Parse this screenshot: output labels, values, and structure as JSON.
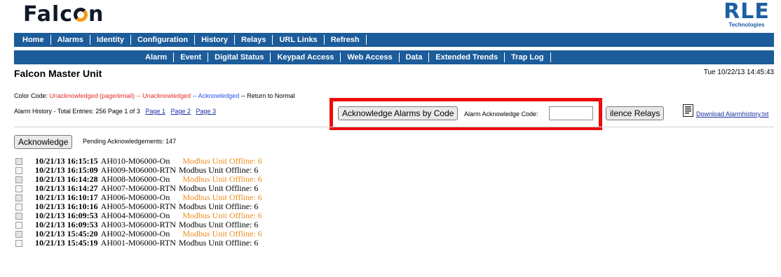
{
  "header": {
    "logo_left": "Falcon",
    "logo_right_main": "RLE",
    "logo_right_sub": "Technologies"
  },
  "nav_primary": [
    "Home",
    "Alarms",
    "Identity",
    "Configuration",
    "History",
    "Relays",
    "URL Links",
    "Refresh"
  ],
  "nav_secondary": [
    "Alarm",
    "Event",
    "Digital Status",
    "Keypad Access",
    "Web Access",
    "Data",
    "Extended Trends",
    "Trap Log"
  ],
  "page": {
    "title": "Falcon Master Unit",
    "datetime": "Tue 10/22/13 14:45:43"
  },
  "color_code": {
    "label": "Color Code: ",
    "unack_email": "Unacknowledged (page/email)",
    "sep1": " -- ",
    "unack": "Unacknowledged",
    "sep2": " -- ",
    "ack": "Acknowledged",
    "sep3": " -- ",
    "rtn": "Return to Normal"
  },
  "history": {
    "summary": "Alarm History - Total Entries: 256  Page 1 of 3",
    "pages": [
      "Page 1",
      "Page 2",
      "Page 3"
    ]
  },
  "ack_by_code": {
    "button": "Acknowledge Alarms by Code",
    "label": "Alarm Acknowledge Code:",
    "value": ""
  },
  "silence_button": "Silence Relays",
  "silence_button_visible": "ilence Relays",
  "download_link": "Download Alarmhistory.txt",
  "acknowledge_button": "Acknowledge",
  "pending": "Pending Acknowledgements: 147",
  "colors": {
    "nav_bg": "#1c5c9a",
    "unacknowledged": "#f08c1e",
    "highlight_box": "#ee0b0b"
  },
  "alarms": [
    {
      "stamp": "10/21/13 16:15:15",
      "code": "AH010-M06000-On",
      "msg": "Modbus Unit Offline: 6",
      "state": "on"
    },
    {
      "stamp": "10/21/13 16:15:09",
      "code": "AH009-M06000-RTN",
      "msg": "Modbus Unit Offline: 6",
      "state": "rtn"
    },
    {
      "stamp": "10/21/13 16:14:28",
      "code": "AH008-M06000-On",
      "msg": "Modbus Unit Offline: 6",
      "state": "on"
    },
    {
      "stamp": "10/21/13 16:14:27",
      "code": "AH007-M06000-RTN",
      "msg": "Modbus Unit Offline: 6",
      "state": "rtn"
    },
    {
      "stamp": "10/21/13 16:10:17",
      "code": "AH006-M06000-On",
      "msg": "Modbus Unit Offline: 6",
      "state": "on"
    },
    {
      "stamp": "10/21/13 16:10:16",
      "code": "AH005-M06000-RTN",
      "msg": "Modbus Unit Offline: 6",
      "state": "rtn"
    },
    {
      "stamp": "10/21/13 16:09:53",
      "code": "AH004-M06000-On",
      "msg": "Modbus Unit Offline: 6",
      "state": "on"
    },
    {
      "stamp": "10/21/13 16:09:53",
      "code": "AH003-M06000-RTN",
      "msg": "Modbus Unit Offline: 6",
      "state": "rtn"
    },
    {
      "stamp": "10/21/13 15:45:20",
      "code": "AH002-M06000-On",
      "msg": "Modbus Unit Offline: 6",
      "state": "on"
    },
    {
      "stamp": "10/21/13 15:45:19",
      "code": "AH001-M06000-RTN",
      "msg": "Modbus Unit Offline: 6",
      "state": "rtn"
    }
  ]
}
